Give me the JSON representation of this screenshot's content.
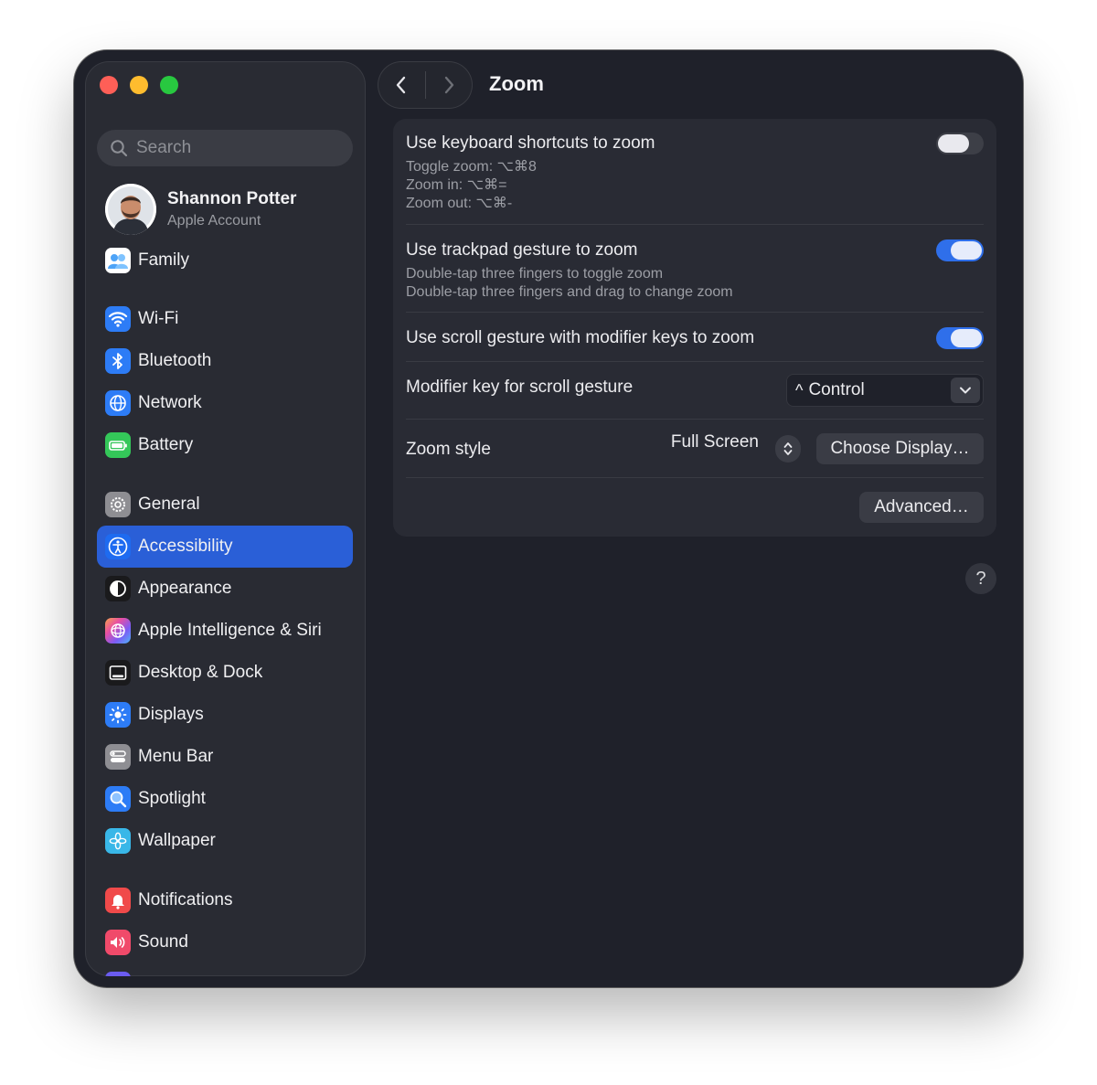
{
  "search": {
    "placeholder": "Search"
  },
  "account": {
    "name": "Shannon Potter",
    "subtitle": "Apple Account"
  },
  "sidebar": {
    "items": [
      {
        "label": "Family",
        "icon": "family-icon"
      },
      {
        "label": "Wi-Fi",
        "icon": "wifi-icon"
      },
      {
        "label": "Bluetooth",
        "icon": "bluetooth-icon"
      },
      {
        "label": "Network",
        "icon": "network-icon"
      },
      {
        "label": "Battery",
        "icon": "battery-icon"
      },
      {
        "label": "General",
        "icon": "gear-icon"
      },
      {
        "label": "Accessibility",
        "icon": "accessibility-icon",
        "selected": true
      },
      {
        "label": "Appearance",
        "icon": "appearance-icon"
      },
      {
        "label": "Apple Intelligence & Siri",
        "icon": "siri-icon"
      },
      {
        "label": "Desktop & Dock",
        "icon": "dock-icon"
      },
      {
        "label": "Displays",
        "icon": "displays-icon"
      },
      {
        "label": "Menu Bar",
        "icon": "menu-bar-icon"
      },
      {
        "label": "Spotlight",
        "icon": "spotlight-icon"
      },
      {
        "label": "Wallpaper",
        "icon": "wallpaper-icon"
      },
      {
        "label": "Notifications",
        "icon": "notifications-icon"
      },
      {
        "label": "Sound",
        "icon": "sound-icon"
      }
    ]
  },
  "header": {
    "title": "Zoom"
  },
  "settings": {
    "keyboard": {
      "title": "Use keyboard shortcuts to zoom",
      "lines": [
        "Toggle zoom: ⌥⌘8",
        "Zoom in: ⌥⌘=",
        "Zoom out: ⌥⌘-"
      ],
      "enabled": false
    },
    "trackpad": {
      "title": "Use trackpad gesture to zoom",
      "lines": [
        "Double-tap three fingers to toggle zoom",
        "Double-tap three fingers and drag to change zoom"
      ],
      "enabled": true
    },
    "scroll": {
      "title": "Use scroll gesture with modifier keys to zoom",
      "enabled": true
    },
    "modifier": {
      "title": "Modifier key for scroll gesture",
      "symbol": "^",
      "value": "Control"
    },
    "style": {
      "title": "Zoom style",
      "value": "Full Screen",
      "choose_label": "Choose Display…"
    },
    "advanced_label": "Advanced…"
  },
  "help_label": "?",
  "colors": {
    "accent": "#2f6fea",
    "selection": "#2a5fd7",
    "window_bg": "#1f212a",
    "sidebar_bg": "#292b33"
  }
}
